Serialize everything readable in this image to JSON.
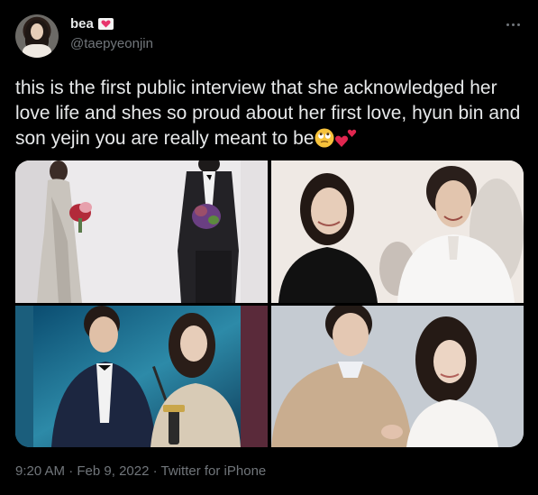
{
  "tweet": {
    "display_name": "bea",
    "handle": "@taepyeonjin",
    "text": "this is the first public interview that she acknowledged her love life and shes so proud about her first love, hyun bin and son yejin you are really meant to be",
    "emojis": [
      "face-with-rolling-eyes-emoji",
      "two-hearts-emoji"
    ],
    "time": "9:20 AM",
    "separator": "·",
    "date": "Feb 9, 2022",
    "source": "Twitter for iPhone"
  },
  "media": {
    "photos": [
      {
        "name": "red-carpet-bouquets-photo"
      },
      {
        "name": "smiling-couple-photo"
      },
      {
        "name": "award-stage-photo"
      },
      {
        "name": "photoshoot-couple-photo"
      }
    ]
  },
  "colors": {
    "background": "#000000",
    "text_primary": "#e7e9ea",
    "text_secondary": "#71767b",
    "heart_badge": "#e8356d"
  }
}
